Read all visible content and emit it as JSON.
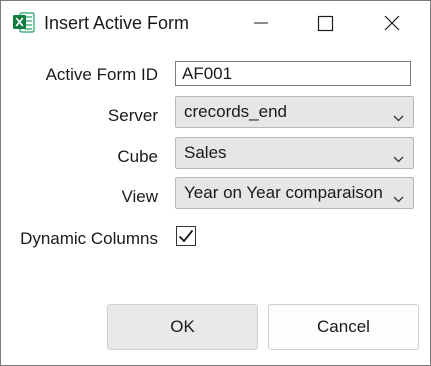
{
  "window": {
    "title": "Insert Active Form",
    "app_icon": "excel-icon",
    "controls": {
      "minimize": "minimize-icon",
      "maximize": "maximize-icon",
      "close": "close-icon"
    }
  },
  "form": {
    "active_form_id": {
      "label": "Active Form ID",
      "value": "AF001"
    },
    "server": {
      "label": "Server",
      "value": "crecords_end"
    },
    "cube": {
      "label": "Cube",
      "value": "Sales"
    },
    "view": {
      "label": "View",
      "value": "Year on Year comparaison"
    },
    "dynamic_columns": {
      "label": "Dynamic Columns",
      "checked": true
    }
  },
  "buttons": {
    "ok": "OK",
    "cancel": "Cancel"
  },
  "colors": {
    "excel_green": "#107c41",
    "button_bg": "#e9e9e9",
    "combo_bg": "#e6e6e6"
  }
}
